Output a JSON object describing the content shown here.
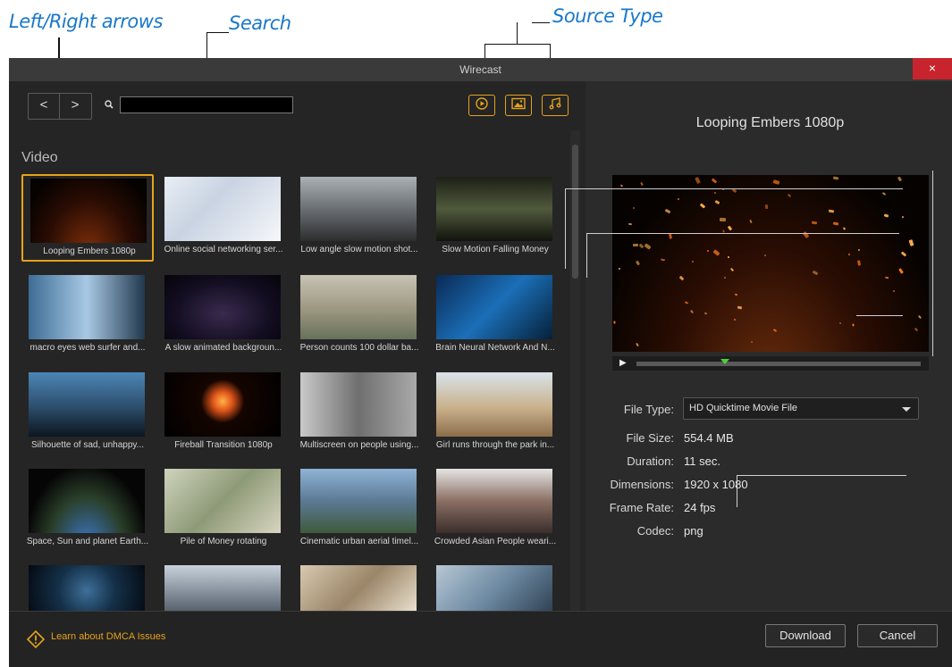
{
  "annotations": {
    "left_right_arrows": "Left/Right arrows",
    "search": "Search",
    "source_type": "Source Type"
  },
  "window": {
    "title": "Wirecast",
    "close_label": "×"
  },
  "toolbar": {
    "back_label": "<",
    "forward_label": ">",
    "search_value": "",
    "source_types": [
      "video-icon",
      "image-icon",
      "audio-icon"
    ],
    "accent_color": "#e6a21a"
  },
  "library": {
    "section_title": "Video",
    "items": [
      {
        "label": "Looping Embers 1080p",
        "selected": true
      },
      {
        "label": "Online social networking ser..."
      },
      {
        "label": "Low angle slow motion shot..."
      },
      {
        "label": "Slow Motion Falling Money"
      },
      {
        "label": "macro eyes web surfer and..."
      },
      {
        "label": "A slow animated backgroun..."
      },
      {
        "label": "Person counts 100 dollar ba..."
      },
      {
        "label": "Brain Neural Network And N..."
      },
      {
        "label": "Silhouette of sad, unhappy..."
      },
      {
        "label": "Fireball Transition 1080p"
      },
      {
        "label": "Multiscreen on people using..."
      },
      {
        "label": "Girl runs through the park in..."
      },
      {
        "label": "Space, Sun and planet Earth..."
      },
      {
        "label": "Pile of Money rotating"
      },
      {
        "label": "Cinematic urban aerial timel..."
      },
      {
        "label": "Crowded Asian People weari..."
      },
      {
        "label": ""
      },
      {
        "label": ""
      },
      {
        "label": ""
      },
      {
        "label": ""
      }
    ]
  },
  "details": {
    "title": "Looping Embers 1080p",
    "file_type_label": "File Type:",
    "file_type_value": "HD Quicktime Movie File",
    "file_size_label": "File Size:",
    "file_size_value": "554.4 MB",
    "duration_label": "Duration:",
    "duration_value": "11 sec.",
    "dimensions_label": "Dimensions:",
    "dimensions_value": "1920 x 1080",
    "frame_rate_label": "Frame Rate:",
    "frame_rate_value": "24 fps",
    "codec_label": "Codec:",
    "codec_value": "png",
    "playback_progress": 0.31
  },
  "footer": {
    "dmca_label": "Learn about DMCA Issues",
    "download_label": "Download",
    "cancel_label": "Cancel"
  }
}
